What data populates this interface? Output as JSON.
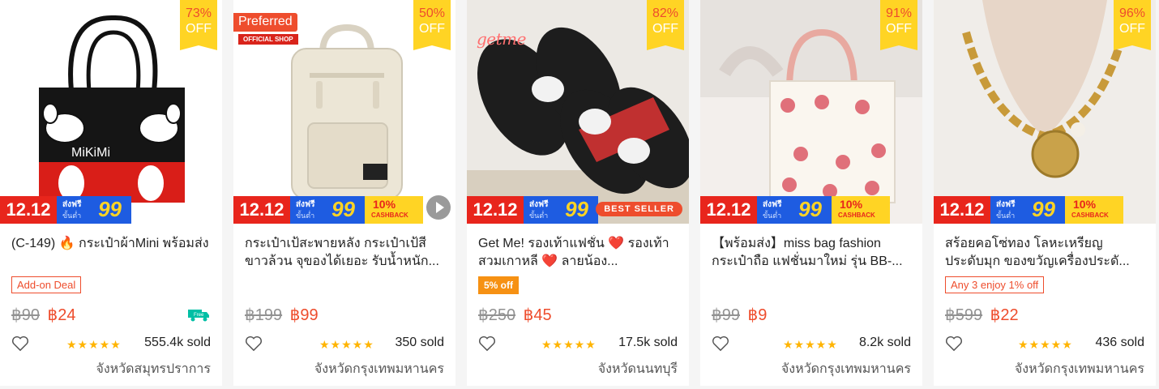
{
  "promo_banner": {
    "sale": "12.12",
    "ship_title": "ส่งฟรี",
    "ship_sub": "ขั้นต่ำ",
    "ship_min": "99",
    "cashback_pct": "10%",
    "cashback_label": "CASHBACK"
  },
  "off_label": "OFF",
  "products": [
    {
      "discount": "73%",
      "name": "(C-149) 🔥 กระเป๋าผ้าMini พร้อมส่ง",
      "tag": "Add-on Deal",
      "orig_price": "฿90",
      "price": "฿24",
      "stars": "★★★★★",
      "sold": "555.4k sold",
      "location": "จังหวัดสมุทรปราการ",
      "image_text": "MiKiMi"
    },
    {
      "discount": "50%",
      "preferred": "Preferred",
      "official": "OFFICIAL SHOP",
      "name": "กระเป๋าเป้สะพายหลัง กระเป๋าเป้สีขาวล้วน จุของได้เยอะ รับน้ำหนัก...",
      "orig_price": "฿199",
      "price": "฿99",
      "stars": "★★★★★",
      "sold": "350 sold",
      "location": "จังหวัดกรุงเทพมหานคร"
    },
    {
      "discount": "82%",
      "brand": "getme",
      "best_seller": "BEST SELLER",
      "name": "Get Me! รองเท้าแฟชั่น ❤️ รองเท้าสวมเกาหลี ❤️ ลายน้อง...",
      "tag": "5% off",
      "orig_price": "฿250",
      "price": "฿45",
      "stars": "★★★★★",
      "sold": "17.5k sold",
      "location": "จังหวัดนนทบุรี"
    },
    {
      "discount": "91%",
      "name": "【พร้อมส่ง】miss bag fashion กระเป๋าถือ แฟชั่นมาใหม่ รุ่น BB-...",
      "orig_price": "฿99",
      "price": "฿9",
      "stars": "★★★★★",
      "sold": "8.2k sold",
      "location": "จังหวัดกรุงเทพมหานคร"
    },
    {
      "discount": "96%",
      "name": "สร้อยคอโซ่ทอง โลหะเหรียญ ประดับมุก ของขวัญเครื่องประดั...",
      "tag": "Any 3 enjoy 1% off",
      "orig_price": "฿599",
      "price": "฿22",
      "stars": "★★★★★",
      "sold": "436 sold",
      "location": "จังหวัดกรุงเทพมหานคร"
    }
  ],
  "colors": {
    "brand": "#ee4d2d",
    "badge": "#ffd424",
    "star": "#ffb400",
    "ship_blue": "#1e5ce1"
  }
}
